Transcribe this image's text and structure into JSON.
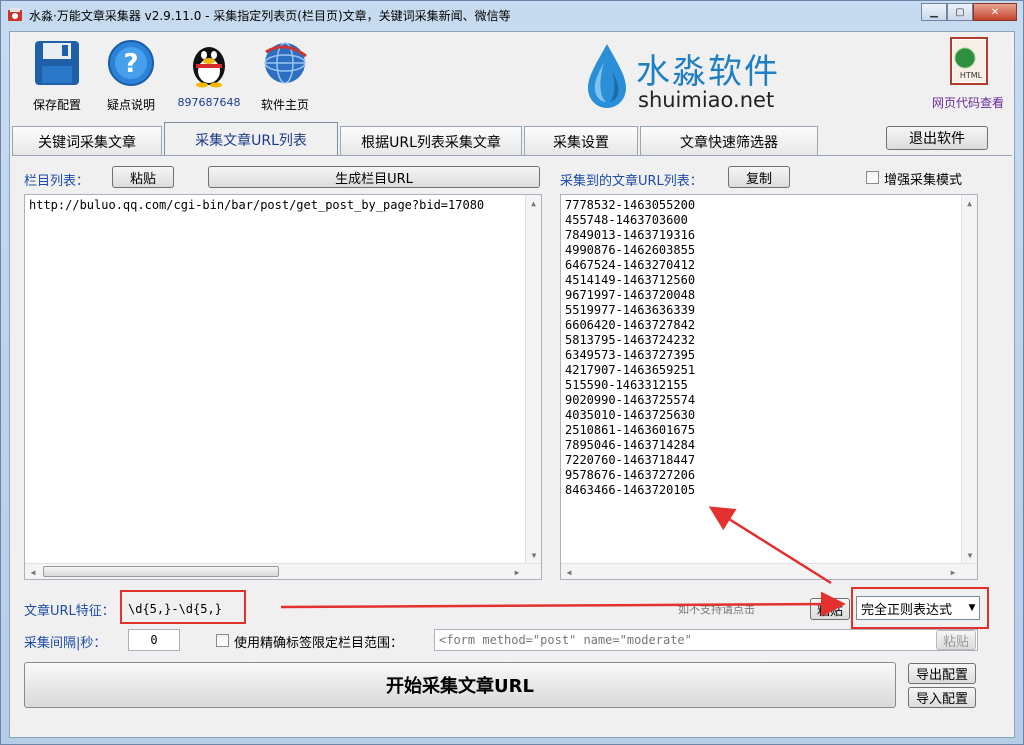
{
  "window": {
    "title": "水淼·万能文章采集器 v2.9.11.0 - 采集指定列表页(栏目页)文章，关键词采集新闻、微信等",
    "controls": [
      "minimize",
      "maximize",
      "close"
    ]
  },
  "toolbar": {
    "save": "保存配置",
    "help": "疑点说明",
    "qq": "897687648",
    "homepage": "软件主页",
    "html_view": "网页代码查看",
    "html_badge": "HTML"
  },
  "brand": {
    "cn": "水淼软件",
    "en": "shuimiao.net"
  },
  "tabs": [
    {
      "label": "关键词采集文章",
      "active": false
    },
    {
      "label": "采集文章URL列表",
      "active": true
    },
    {
      "label": "根据URL列表采集文章",
      "active": false
    },
    {
      "label": "采集设置",
      "active": false
    },
    {
      "label": "文章快速筛选器",
      "active": false
    }
  ],
  "exit_button": "退出软件",
  "left_panel": {
    "label": "栏目列表：",
    "paste_button": "粘贴",
    "generate_button": "生成栏目URL",
    "content": "http://buluo.qq.com/cgi-bin/bar/post/get_post_by_page?bid=17080"
  },
  "right_panel": {
    "label": "采集到的文章URL列表：",
    "copy_button": "复制",
    "enhanced_mode_label": "增强采集模式",
    "urls": [
      "7778532-1463055200",
      "455748-1463703600",
      "7849013-1463719316",
      "4990876-1462603855",
      "6467524-1463270412",
      "4514149-1463712560",
      "9671997-1463720048",
      "5519977-1463636339",
      "6606420-1463727842",
      "5813795-1463724232",
      "6349573-1463727395",
      "4217907-1463659251",
      "515590-1463312155",
      "9020990-1463725574",
      "4035010-1463725630",
      "2510861-1463601675",
      "7895046-1463714284",
      "7220760-1463718447",
      "9578676-1463727206",
      "8463466-1463720105"
    ]
  },
  "feature": {
    "label": "文章URL特征：",
    "value": "\\d{5,}-\\d{5,}",
    "hint": "如不支持请点击",
    "paste_button": "粘贴",
    "mode_select": "完全正则表达式"
  },
  "interval": {
    "label": "采集间隔|秒：",
    "value": "0"
  },
  "precise_tag": {
    "label": "使用精确标签限定栏目范围：",
    "value": "<form method=\"post\" name=\"moderate\"",
    "paste_button": "粘贴"
  },
  "start_button": "开始采集文章URL",
  "export_button": "导出配置",
  "import_button": "导入配置",
  "colors": {
    "annotation_red": "#e2312f",
    "label_blue": "#1d4ba6",
    "brand_blue": "#1e7fc4"
  }
}
